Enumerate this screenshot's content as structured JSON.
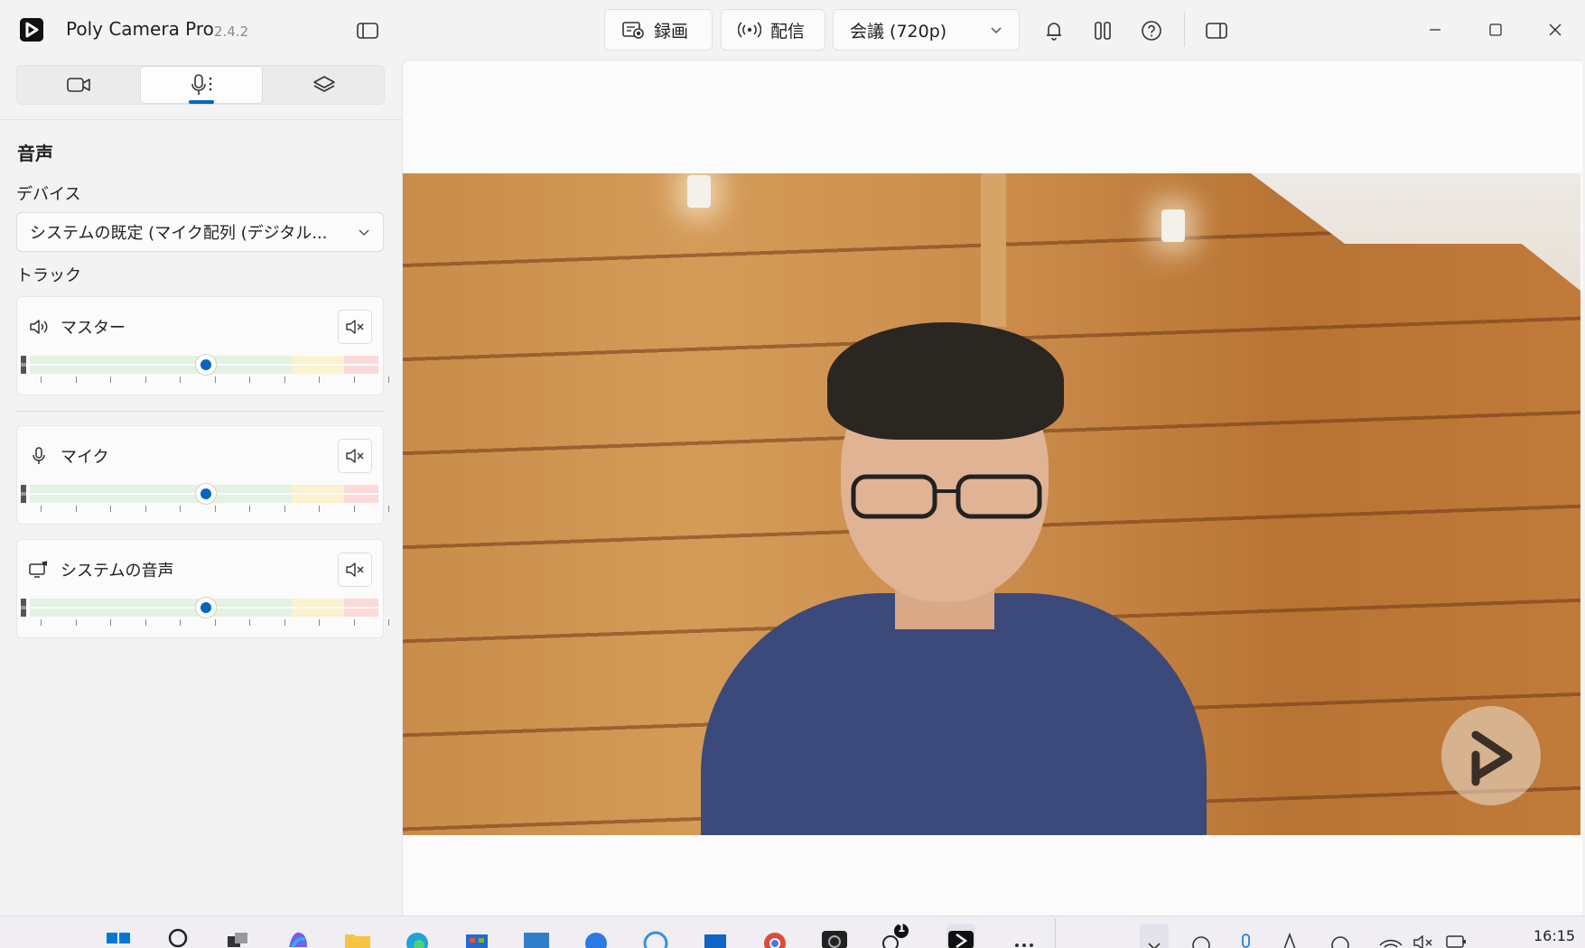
{
  "app": {
    "title": "Poly Camera Pro",
    "version": "2.4.2"
  },
  "toolbar": {
    "record_label": "録画",
    "broadcast_label": "配信",
    "mode_selected": "会議 (720p)"
  },
  "colors": {
    "accent": "#0067c0",
    "meter_green": "#e3f2e3",
    "meter_yellow": "#fbf2cf",
    "meter_red": "#fcd9d9"
  },
  "audio": {
    "section_title": "音声",
    "device_label": "デバイス",
    "device_selected": "システムの既定 (マイク配列 (デジタル...",
    "tracks_label": "トラック",
    "tracks": [
      {
        "name": "マスター",
        "icon": "speaker-icon",
        "level": 0.52
      },
      {
        "name": "マイク",
        "icon": "microphone-icon",
        "level": 0.52
      },
      {
        "name": "システムの音声",
        "icon": "monitor-audio-icon",
        "level": 0.52
      }
    ]
  },
  "taskbar": {
    "clock": "16:15",
    "badge_count": "1"
  }
}
